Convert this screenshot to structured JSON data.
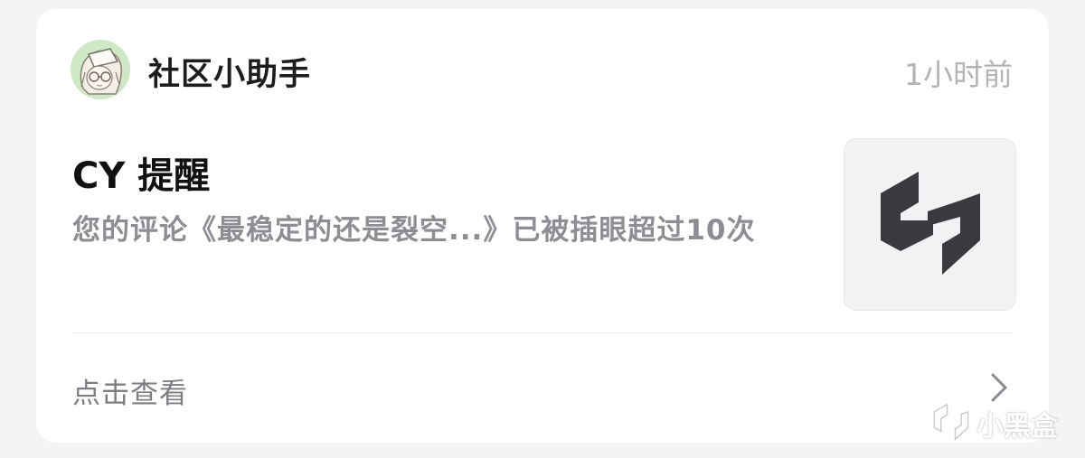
{
  "notification": {
    "sender": "社区小助手",
    "time": "1小时前",
    "title": "CY 提醒",
    "body": "您的评论《最稳定的还是裂空...》已被插眼超过10次",
    "action_label": "点击查看"
  },
  "watermark": {
    "text": "小黑盒"
  },
  "icons": {
    "avatar": "assistant-avatar",
    "thumbnail": "heybox-logo-icon",
    "chevron": "chevron-right-icon",
    "watermark_logo": "heybox-logo-icon"
  },
  "colors": {
    "card_background": "#ffffff",
    "page_background": "#f4f4f6",
    "avatar_background": "#cfe9c6",
    "logo_color": "#3a3a3e"
  }
}
